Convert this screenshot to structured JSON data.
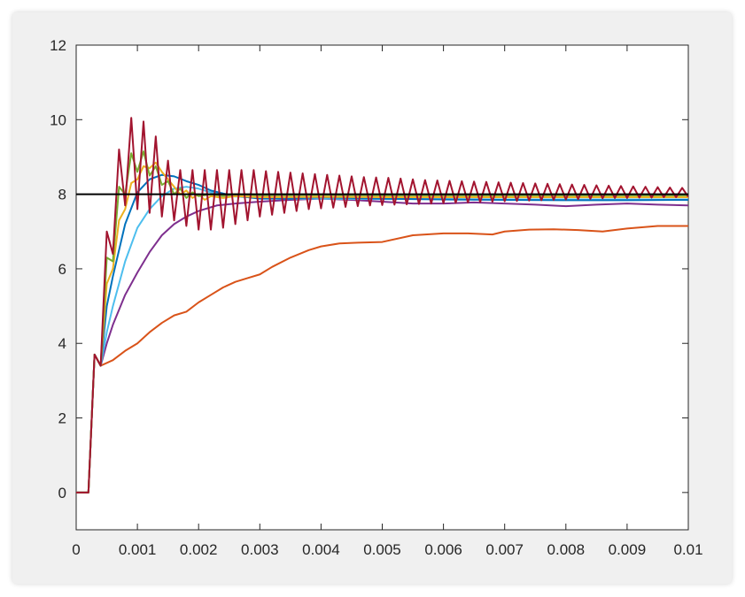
{
  "chart_data": {
    "type": "line",
    "title": "",
    "xlabel": "",
    "ylabel": "",
    "xlim": [
      0,
      0.01
    ],
    "ylim": [
      -1,
      12
    ],
    "grid": false,
    "x_ticks": [
      0,
      0.001,
      0.002,
      0.003,
      0.004,
      0.005,
      0.006,
      0.007,
      0.008,
      0.009,
      0.01
    ],
    "x_tick_labels": [
      "0",
      "0.001",
      "0.002",
      "0.003",
      "0.004",
      "0.005",
      "0.006",
      "0.007",
      "0.008",
      "0.009",
      "0.01"
    ],
    "y_ticks": [
      0,
      2,
      4,
      6,
      8,
      10,
      12
    ],
    "y_tick_labels": [
      "0",
      "2",
      "4",
      "6",
      "8",
      "10",
      "12"
    ],
    "reference_line": {
      "y": 8,
      "color": "#000000"
    },
    "series": [
      {
        "color": "#D95319",
        "points": [
          [
            0,
            0
          ],
          [
            0.0002,
            0
          ],
          [
            0.0003,
            3.7
          ],
          [
            0.0004,
            3.4
          ],
          [
            0.0006,
            3.55
          ],
          [
            0.0008,
            3.8
          ],
          [
            0.001,
            4.0
          ],
          [
            0.0012,
            4.3
          ],
          [
            0.0014,
            4.55
          ],
          [
            0.0016,
            4.75
          ],
          [
            0.0018,
            4.85
          ],
          [
            0.002,
            5.1
          ],
          [
            0.0022,
            5.3
          ],
          [
            0.0024,
            5.5
          ],
          [
            0.0026,
            5.65
          ],
          [
            0.0028,
            5.75
          ],
          [
            0.003,
            5.85
          ],
          [
            0.0032,
            6.05
          ],
          [
            0.0035,
            6.3
          ],
          [
            0.0038,
            6.5
          ],
          [
            0.004,
            6.6
          ],
          [
            0.0043,
            6.68
          ],
          [
            0.0046,
            6.7
          ],
          [
            0.005,
            6.72
          ],
          [
            0.0055,
            6.9
          ],
          [
            0.006,
            6.95
          ],
          [
            0.0064,
            6.95
          ],
          [
            0.0068,
            6.92
          ],
          [
            0.007,
            7.0
          ],
          [
            0.0074,
            7.05
          ],
          [
            0.0078,
            7.06
          ],
          [
            0.0082,
            7.04
          ],
          [
            0.0086,
            7.0
          ],
          [
            0.009,
            7.08
          ],
          [
            0.0095,
            7.15
          ],
          [
            0.01,
            7.15
          ]
        ]
      },
      {
        "color": "#7E2F8E",
        "points": [
          [
            0,
            0
          ],
          [
            0.0002,
            0
          ],
          [
            0.0003,
            3.7
          ],
          [
            0.0004,
            3.4
          ],
          [
            0.0005,
            4.0
          ],
          [
            0.0006,
            4.5
          ],
          [
            0.0008,
            5.3
          ],
          [
            0.001,
            5.9
          ],
          [
            0.0012,
            6.45
          ],
          [
            0.0014,
            6.9
          ],
          [
            0.0016,
            7.2
          ],
          [
            0.0018,
            7.4
          ],
          [
            0.002,
            7.55
          ],
          [
            0.0023,
            7.7
          ],
          [
            0.0026,
            7.75
          ],
          [
            0.003,
            7.8
          ],
          [
            0.0035,
            7.85
          ],
          [
            0.004,
            7.88
          ],
          [
            0.0045,
            7.85
          ],
          [
            0.005,
            7.8
          ],
          [
            0.0055,
            7.75
          ],
          [
            0.006,
            7.75
          ],
          [
            0.0065,
            7.78
          ],
          [
            0.007,
            7.75
          ],
          [
            0.0075,
            7.72
          ],
          [
            0.008,
            7.68
          ],
          [
            0.0085,
            7.72
          ],
          [
            0.009,
            7.75
          ],
          [
            0.0095,
            7.72
          ],
          [
            0.01,
            7.7
          ]
        ]
      },
      {
        "color": "#4DBEEE",
        "points": [
          [
            0,
            0
          ],
          [
            0.0002,
            0
          ],
          [
            0.0003,
            3.7
          ],
          [
            0.0004,
            3.4
          ],
          [
            0.0005,
            4.3
          ],
          [
            0.0006,
            5.0
          ],
          [
            0.0008,
            6.2
          ],
          [
            0.001,
            7.1
          ],
          [
            0.0012,
            7.6
          ],
          [
            0.0014,
            7.95
          ],
          [
            0.0016,
            8.15
          ],
          [
            0.0018,
            8.2
          ],
          [
            0.002,
            8.15
          ],
          [
            0.0022,
            8.05
          ],
          [
            0.0025,
            7.95
          ],
          [
            0.003,
            7.9
          ],
          [
            0.0035,
            7.88
          ],
          [
            0.004,
            7.88
          ],
          [
            0.005,
            7.87
          ],
          [
            0.006,
            7.87
          ],
          [
            0.007,
            7.86
          ],
          [
            0.008,
            7.86
          ],
          [
            0.009,
            7.86
          ],
          [
            0.01,
            7.86
          ]
        ]
      },
      {
        "color": "#0072BD",
        "points": [
          [
            0,
            0
          ],
          [
            0.0002,
            0
          ],
          [
            0.0003,
            3.7
          ],
          [
            0.0004,
            3.4
          ],
          [
            0.0005,
            5.0
          ],
          [
            0.0006,
            5.8
          ],
          [
            0.0008,
            7.2
          ],
          [
            0.001,
            8.05
          ],
          [
            0.0012,
            8.4
          ],
          [
            0.0014,
            8.52
          ],
          [
            0.0016,
            8.48
          ],
          [
            0.0018,
            8.35
          ],
          [
            0.002,
            8.25
          ],
          [
            0.0022,
            8.1
          ],
          [
            0.0025,
            7.98
          ],
          [
            0.003,
            7.88
          ],
          [
            0.0035,
            7.88
          ],
          [
            0.004,
            7.92
          ],
          [
            0.0045,
            7.9
          ],
          [
            0.005,
            7.88
          ],
          [
            0.006,
            7.86
          ],
          [
            0.007,
            7.85
          ],
          [
            0.008,
            7.84
          ],
          [
            0.009,
            7.84
          ],
          [
            0.01,
            7.85
          ]
        ]
      },
      {
        "color": "#EDB120",
        "points": [
          [
            0,
            0
          ],
          [
            0.0002,
            0
          ],
          [
            0.0003,
            3.7
          ],
          [
            0.0004,
            3.4
          ],
          [
            0.0005,
            5.6
          ],
          [
            0.0006,
            6.0
          ],
          [
            0.0007,
            7.3
          ],
          [
            0.0008,
            7.6
          ],
          [
            0.0009,
            8.3
          ],
          [
            0.001,
            8.4
          ],
          [
            0.0011,
            8.75
          ],
          [
            0.0012,
            8.7
          ],
          [
            0.0013,
            8.85
          ],
          [
            0.0014,
            8.6
          ],
          [
            0.0015,
            8.4
          ],
          [
            0.0016,
            8.2
          ],
          [
            0.0017,
            8.0
          ],
          [
            0.0018,
            8.1
          ],
          [
            0.0019,
            7.9
          ],
          [
            0.002,
            8.0
          ],
          [
            0.0021,
            7.85
          ],
          [
            0.0022,
            7.95
          ],
          [
            0.0024,
            7.9
          ],
          [
            0.0026,
            7.95
          ],
          [
            0.003,
            7.92
          ],
          [
            0.004,
            7.93
          ],
          [
            0.005,
            7.92
          ],
          [
            0.006,
            7.92
          ],
          [
            0.007,
            7.92
          ],
          [
            0.008,
            7.92
          ],
          [
            0.009,
            7.92
          ],
          [
            0.01,
            7.92
          ]
        ]
      },
      {
        "color": "#77AC30",
        "points": [
          [
            0,
            0
          ],
          [
            0.0002,
            0
          ],
          [
            0.0003,
            3.7
          ],
          [
            0.0004,
            3.4
          ],
          [
            0.0005,
            6.3
          ],
          [
            0.0006,
            6.2
          ],
          [
            0.0007,
            8.2
          ],
          [
            0.0008,
            8.0
          ],
          [
            0.0009,
            9.1
          ],
          [
            0.001,
            8.6
          ],
          [
            0.0011,
            9.15
          ],
          [
            0.0012,
            8.5
          ],
          [
            0.0013,
            8.75
          ],
          [
            0.0014,
            8.25
          ],
          [
            0.0015,
            8.35
          ],
          [
            0.0016,
            8.0
          ],
          [
            0.0017,
            8.15
          ],
          [
            0.0018,
            7.9
          ],
          [
            0.0019,
            8.05
          ],
          [
            0.002,
            7.95
          ],
          [
            0.0022,
            8.0
          ],
          [
            0.0024,
            7.95
          ],
          [
            0.0026,
            8.0
          ],
          [
            0.003,
            7.97
          ],
          [
            0.004,
            7.98
          ],
          [
            0.005,
            7.97
          ],
          [
            0.006,
            7.97
          ],
          [
            0.007,
            7.97
          ],
          [
            0.008,
            7.97
          ],
          [
            0.009,
            7.97
          ],
          [
            0.01,
            7.97
          ]
        ]
      },
      {
        "color": "#A2142F",
        "points": [
          [
            0,
            0
          ],
          [
            0.0002,
            0
          ],
          [
            0.0003,
            3.7
          ],
          [
            0.0004,
            3.4
          ],
          [
            0.0005,
            7.0
          ],
          [
            0.0006,
            6.4
          ],
          [
            0.0007,
            9.2
          ],
          [
            0.0008,
            7.7
          ],
          [
            0.0009,
            10.05
          ],
          [
            0.001,
            7.6
          ],
          [
            0.0011,
            9.95
          ],
          [
            0.0012,
            7.5
          ],
          [
            0.0013,
            9.55
          ],
          [
            0.0014,
            7.4
          ],
          [
            0.0015,
            8.9
          ],
          [
            0.0016,
            7.3
          ],
          [
            0.0017,
            8.65
          ],
          [
            0.0018,
            7.15
          ],
          [
            0.0019,
            8.65
          ],
          [
            0.002,
            7.05
          ],
          [
            0.0021,
            8.65
          ],
          [
            0.0022,
            7.05
          ],
          [
            0.0023,
            8.65
          ],
          [
            0.0024,
            7.1
          ],
          [
            0.0025,
            8.65
          ],
          [
            0.0026,
            7.2
          ],
          [
            0.0027,
            8.65
          ],
          [
            0.0028,
            7.3
          ],
          [
            0.0029,
            8.65
          ],
          [
            0.003,
            7.4
          ],
          [
            0.0031,
            8.62
          ],
          [
            0.0032,
            7.45
          ],
          [
            0.0033,
            8.6
          ],
          [
            0.0034,
            7.5
          ],
          [
            0.0035,
            8.58
          ],
          [
            0.0036,
            7.55
          ],
          [
            0.0037,
            8.56
          ],
          [
            0.0038,
            7.6
          ],
          [
            0.0039,
            8.54
          ],
          [
            0.004,
            7.62
          ],
          [
            0.0041,
            8.52
          ],
          [
            0.0042,
            7.64
          ],
          [
            0.0043,
            8.5
          ],
          [
            0.0044,
            7.66
          ],
          [
            0.0045,
            8.48
          ],
          [
            0.0046,
            7.68
          ],
          [
            0.0047,
            8.46
          ],
          [
            0.0048,
            7.7
          ],
          [
            0.0049,
            8.45
          ],
          [
            0.005,
            7.71
          ],
          [
            0.0051,
            8.44
          ],
          [
            0.0052,
            7.72
          ],
          [
            0.0053,
            8.42
          ],
          [
            0.0054,
            7.73
          ],
          [
            0.0055,
            8.4
          ],
          [
            0.0056,
            7.74
          ],
          [
            0.0057,
            8.38
          ],
          [
            0.0058,
            7.75
          ],
          [
            0.0059,
            8.37
          ],
          [
            0.006,
            7.76
          ],
          [
            0.0061,
            8.36
          ],
          [
            0.0062,
            7.77
          ],
          [
            0.0063,
            8.35
          ],
          [
            0.0064,
            7.78
          ],
          [
            0.0065,
            8.34
          ],
          [
            0.0066,
            7.79
          ],
          [
            0.0067,
            8.33
          ],
          [
            0.0068,
            7.8
          ],
          [
            0.0069,
            8.32
          ],
          [
            0.007,
            7.81
          ],
          [
            0.0071,
            8.31
          ],
          [
            0.0072,
            7.82
          ],
          [
            0.0073,
            8.3
          ],
          [
            0.0074,
            7.83
          ],
          [
            0.0075,
            8.29
          ],
          [
            0.0076,
            7.84
          ],
          [
            0.0077,
            8.28
          ],
          [
            0.0078,
            7.85
          ],
          [
            0.0079,
            8.27
          ],
          [
            0.008,
            7.86
          ],
          [
            0.0081,
            8.26
          ],
          [
            0.0082,
            7.87
          ],
          [
            0.0083,
            8.25
          ],
          [
            0.0084,
            7.88
          ],
          [
            0.0085,
            8.24
          ],
          [
            0.0086,
            7.89
          ],
          [
            0.0087,
            8.23
          ],
          [
            0.0088,
            7.9
          ],
          [
            0.0089,
            8.22
          ],
          [
            0.009,
            7.9
          ],
          [
            0.0091,
            8.21
          ],
          [
            0.0092,
            7.91
          ],
          [
            0.0093,
            8.2
          ],
          [
            0.0094,
            7.91
          ],
          [
            0.0095,
            8.19
          ],
          [
            0.0096,
            7.92
          ],
          [
            0.0097,
            8.18
          ],
          [
            0.0098,
            7.92
          ],
          [
            0.0099,
            8.17
          ],
          [
            0.01,
            7.93
          ]
        ]
      }
    ]
  }
}
